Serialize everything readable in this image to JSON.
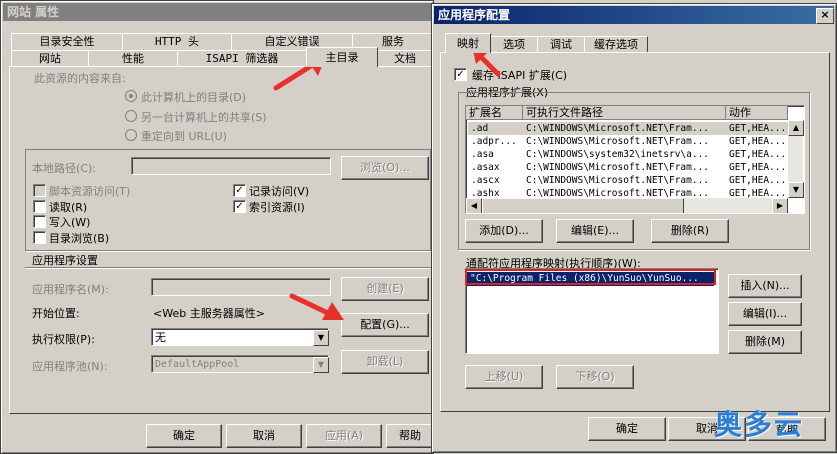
{
  "props": {
    "title": "网站 属性",
    "tabs_row1": [
      "目录安全性",
      "HTTP 头",
      "自定义错误",
      "服务"
    ],
    "tabs_row2": [
      "网站",
      "性能",
      "ISAPI 筛选器",
      "主目录",
      "文档"
    ],
    "content_source": "此资源的内容来自:",
    "radio1": "此计算机上的目录(D)",
    "radio2": "另一台计算机上的共享(S)",
    "radio3": "重定向到 URL(U)",
    "local_path": "本地路径(C):",
    "browse": "浏览(O)...",
    "script_access": "脚本资源访问(T)",
    "read": "读取(R)",
    "write": "写入(W)",
    "dir_browse": "目录浏览(B)",
    "log_visits": "记录访问(V)",
    "index": "索引资源(I)",
    "app_settings": "应用程序设置",
    "app_name": "应用程序名(M):",
    "create": "创建(E)",
    "start_pos": "开始位置:",
    "start_pos_value": "<Web 主服务器属性>",
    "config": "配置(G)...",
    "exec_perm": "执行权限(P):",
    "exec_perm_value": "无",
    "app_pool": "应用程序池(N):",
    "app_pool_value": "DefaultAppPool",
    "unload": "卸载(L)",
    "ok": "确定",
    "cancel": "取消",
    "apply": "应用(A)",
    "help": "帮助"
  },
  "appconf": {
    "title": "应用程序配置",
    "tabs": [
      "映射",
      "选项",
      "调试",
      "缓存选项"
    ],
    "cache_isapi": "缓存 ISAPI 扩展(C)",
    "extensions": "应用程序扩展(X)",
    "columns": [
      "扩展名",
      "可执行文件路径",
      "动作"
    ],
    "rows": [
      [
        ".ad",
        "C:\\WINDOWS\\Microsoft.NET\\Fram...",
        "GET,HEA..."
      ],
      [
        ".adpr...",
        "C:\\WINDOWS\\Microsoft.NET\\Fram...",
        "GET,HEA..."
      ],
      [
        ".asa",
        "C:\\WINDOWS\\system32\\inetsrv\\a...",
        "GET,HEA..."
      ],
      [
        ".asax",
        "C:\\WINDOWS\\Microsoft.NET\\Fram...",
        "GET,HEA..."
      ],
      [
        ".ascx",
        "C:\\WINDOWS\\Microsoft.NET\\Fram...",
        "GET,HEA..."
      ],
      [
        ".ashx",
        "C:\\WINDOWS\\Microsoft.NET\\Fram...",
        "GET,HEA..."
      ]
    ],
    "add": "添加(D)...",
    "edit": "编辑(E)...",
    "remove": "删除(R)",
    "wildcard_label": "通配符应用程序映射(执行顺序)(W):",
    "wildcard_item": "\"C:\\Program Files (x86)\\YunSuo\\YunSuo...",
    "insert": "插入(N)...",
    "edit2": "编辑(I)...",
    "remove2": "删除(M)",
    "move_up": "上移(U)",
    "move_down": "下移(O)",
    "ok": "确定",
    "cancel": "取消",
    "help": "帮助"
  },
  "watermark": "奥多云",
  "colors": {
    "annotation": "#e8312a",
    "highlight_box": "#e02020",
    "watermark": "#2a7fd4"
  }
}
